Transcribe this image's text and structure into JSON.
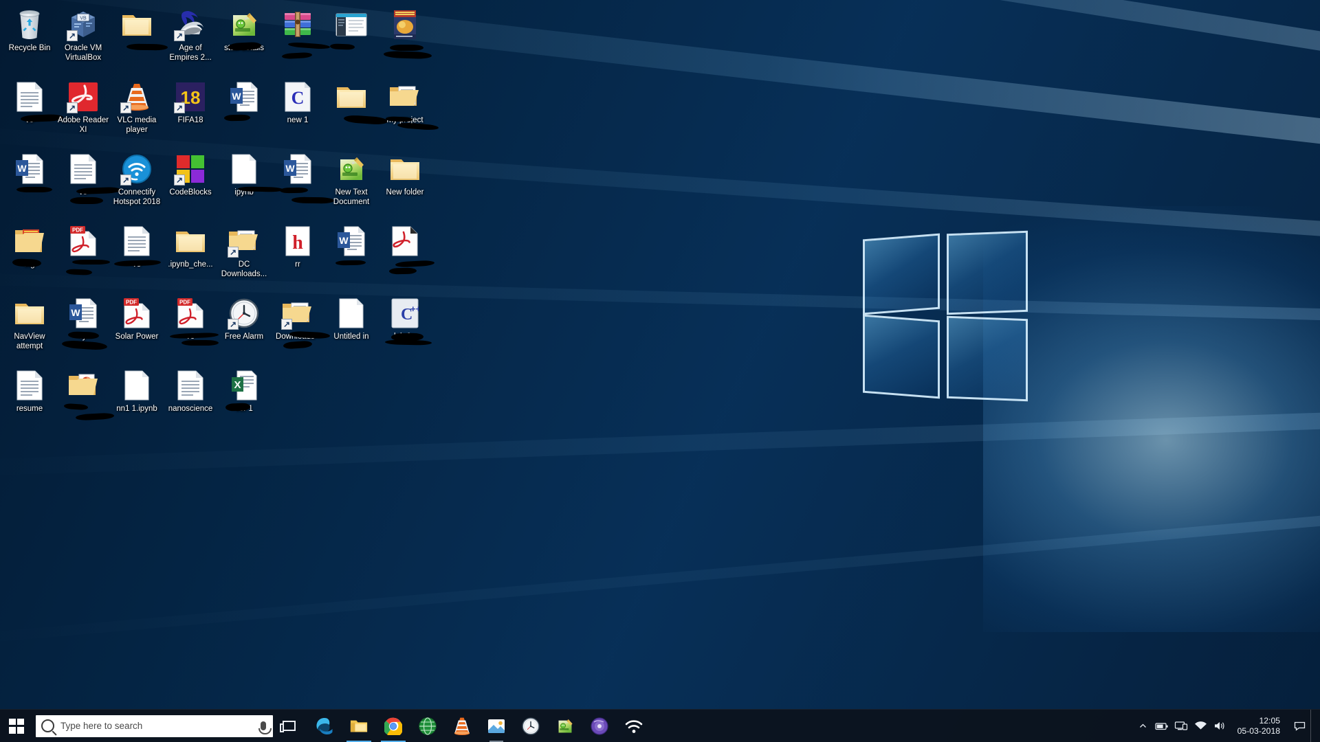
{
  "desktop": {
    "wallpaper_name": "windows-10-hero-wallpaper",
    "icons": [
      {
        "label": "Recycle Bin",
        "icon": "recycle-bin-icon",
        "redacted": false,
        "shortcut": false,
        "kind": "system"
      },
      {
        "label": "Oracle VM VirtualBox",
        "icon": "virtualbox-icon",
        "redacted": false,
        "shortcut": true,
        "kind": "app"
      },
      {
        "label": "",
        "icon": "folder-icon",
        "redacted": true,
        "shortcut": false,
        "kind": "folder"
      },
      {
        "label": "Age of Empires 2...",
        "icon": "age-of-empires-icon",
        "redacted": false,
        "shortcut": true,
        "kind": "app"
      },
      {
        "label": "stuff details",
        "icon": "notepadpp-icon",
        "redacted": true,
        "shortcut": false,
        "kind": "text"
      },
      {
        "label": "",
        "icon": "winrar-archive-icon",
        "redacted": true,
        "shortcut": false,
        "kind": "archive"
      },
      {
        "label": "",
        "icon": "app-window-icon",
        "redacted": true,
        "shortcut": false,
        "kind": "app"
      },
      {
        "label": "",
        "icon": "book-cover-icon",
        "redacted": true,
        "shortcut": false,
        "kind": "image"
      },
      {
        "label": "ve",
        "icon": "document-icon",
        "redacted": true,
        "shortcut": false,
        "kind": "document"
      },
      {
        "label": "Adobe Reader XI",
        "icon": "adobe-reader-icon",
        "redacted": false,
        "shortcut": true,
        "kind": "app"
      },
      {
        "label": "VLC media player",
        "icon": "vlc-cone-icon",
        "redacted": false,
        "shortcut": true,
        "kind": "app"
      },
      {
        "label": "FIFA18",
        "icon": "fifa18-icon",
        "redacted": false,
        "shortcut": true,
        "kind": "app"
      },
      {
        "label": "",
        "icon": "word-document-icon",
        "redacted": true,
        "shortcut": false,
        "kind": "word"
      },
      {
        "label": "new 1",
        "icon": "c-source-file-icon",
        "redacted": false,
        "shortcut": false,
        "kind": "code"
      },
      {
        "label": "",
        "icon": "folder-icon",
        "redacted": true,
        "shortcut": false,
        "kind": "folder"
      },
      {
        "label": "my project",
        "icon": "open-folder-icon",
        "redacted": true,
        "shortcut": false,
        "kind": "folder"
      },
      {
        "label": "",
        "icon": "word-document-icon",
        "redacted": true,
        "shortcut": false,
        "kind": "word"
      },
      {
        "label": "ve",
        "icon": "document-icon",
        "redacted": true,
        "shortcut": false,
        "kind": "document"
      },
      {
        "label": "Connectify Hotspot 2018",
        "icon": "connectify-icon",
        "redacted": false,
        "shortcut": true,
        "kind": "app"
      },
      {
        "label": "CodeBlocks",
        "icon": "codeblocks-icon",
        "redacted": false,
        "shortcut": true,
        "kind": "app"
      },
      {
        "label": "ipynb",
        "icon": "blank-document-icon",
        "redacted": true,
        "shortcut": false,
        "kind": "document"
      },
      {
        "label": "",
        "icon": "word-document-icon",
        "redacted": true,
        "shortcut": false,
        "kind": "word"
      },
      {
        "label": "New Text Document",
        "icon": "notepadpp-icon",
        "redacted": false,
        "shortcut": false,
        "kind": "text"
      },
      {
        "label": "New folder",
        "icon": "folder-icon",
        "redacted": false,
        "shortcut": false,
        "kind": "folder"
      },
      {
        "label": "ing",
        "icon": "book-folder-icon",
        "redacted": true,
        "shortcut": false,
        "kind": "folder"
      },
      {
        "label": "",
        "icon": "pdf-document-icon",
        "redacted": true,
        "shortcut": false,
        "kind": "pdf"
      },
      {
        "label": "ve",
        "icon": "document-icon",
        "redacted": true,
        "shortcut": false,
        "kind": "document"
      },
      {
        "label": ".ipynb_che...",
        "icon": "folder-icon",
        "redacted": false,
        "shortcut": false,
        "kind": "folder"
      },
      {
        "label": "DC Downloads...",
        "icon": "open-folder-icon",
        "redacted": false,
        "shortcut": true,
        "kind": "folder"
      },
      {
        "label": "rr",
        "icon": "h-file-icon",
        "redacted": false,
        "shortcut": false,
        "kind": "code"
      },
      {
        "label": "",
        "icon": "word-document-icon",
        "redacted": true,
        "shortcut": false,
        "kind": "word"
      },
      {
        "label": "",
        "icon": "adobe-document-icon",
        "redacted": true,
        "shortcut": false,
        "kind": "pdf"
      },
      {
        "label": "NavView attempt",
        "icon": "folder-icon",
        "redacted": false,
        "shortcut": false,
        "kind": "folder"
      },
      {
        "label": "fy",
        "icon": "word-document-icon",
        "redacted": true,
        "shortcut": false,
        "kind": "word"
      },
      {
        "label": "Solar Power",
        "icon": "pdf-document-icon",
        "redacted": false,
        "shortcut": false,
        "kind": "pdf"
      },
      {
        "label": "ve",
        "icon": "pdf-document-icon",
        "redacted": true,
        "shortcut": false,
        "kind": "pdf"
      },
      {
        "label": "Free Alarm",
        "icon": "clock-icon",
        "redacted": false,
        "shortcut": true,
        "kind": "app"
      },
      {
        "label": "Downloads -",
        "icon": "open-folder-icon",
        "redacted": true,
        "shortcut": true,
        "kind": "folder"
      },
      {
        "label": "Untitled in",
        "icon": "blank-document-icon",
        "redacted": false,
        "shortcut": false,
        "kind": "document"
      },
      {
        "label": "lab 2 -",
        "icon": "cpp-source-file-icon",
        "redacted": true,
        "shortcut": false,
        "kind": "code"
      },
      {
        "label": "resume",
        "icon": "document-icon",
        "redacted": false,
        "shortcut": false,
        "kind": "document"
      },
      {
        "label": "",
        "icon": "ppt-folder-icon",
        "redacted": true,
        "shortcut": false,
        "kind": "folder"
      },
      {
        "label": "nn1 1.ipynb",
        "icon": "blank-document-icon",
        "redacted": false,
        "shortcut": false,
        "kind": "document"
      },
      {
        "label": "nanoscience",
        "icon": "document-icon",
        "redacted": false,
        "shortcut": false,
        "kind": "document"
      },
      {
        "label": "ver 1",
        "icon": "excel-document-icon",
        "redacted": true,
        "shortcut": false,
        "kind": "excel"
      }
    ]
  },
  "taskbar": {
    "start_label": "Start",
    "search": {
      "placeholder": "Type here to search",
      "value": "",
      "icon": "search-icon",
      "mic_icon": "microphone-icon"
    },
    "task_view_label": "Task View",
    "apps": [
      {
        "name": "Microsoft Edge",
        "icon": "edge-icon",
        "state": "pinned"
      },
      {
        "name": "File Explorer",
        "icon": "file-explorer-icon",
        "state": "active"
      },
      {
        "name": "Google Chrome",
        "icon": "chrome-icon",
        "state": "active"
      },
      {
        "name": "Web Browser",
        "icon": "browser-globe-icon",
        "state": "pinned"
      },
      {
        "name": "VLC media player",
        "icon": "vlc-cone-icon",
        "state": "pinned"
      },
      {
        "name": "Photos",
        "icon": "photos-icon",
        "state": "running"
      },
      {
        "name": "Alarms & Clock",
        "icon": "clock-icon",
        "state": "pinned"
      },
      {
        "name": "Notepad++",
        "icon": "notepadpp-icon",
        "state": "pinned"
      },
      {
        "name": "Media Player",
        "icon": "media-disc-icon",
        "state": "pinned"
      },
      {
        "name": "Wireless Network",
        "icon": "wifi-app-icon",
        "state": "pinned"
      }
    ],
    "tray": {
      "overflow_icon": "chevron-up-icon",
      "items": [
        {
          "name": "Battery",
          "icon": "battery-icon"
        },
        {
          "name": "Network",
          "icon": "network-monitor-icon"
        },
        {
          "name": "Wi-Fi",
          "icon": "wifi-icon"
        },
        {
          "name": "Volume",
          "icon": "speaker-icon"
        }
      ],
      "clock": {
        "time": "12:05",
        "date": "05-03-2018"
      },
      "action_center_icon": "action-center-icon",
      "show_desktop_label": "Show desktop"
    }
  },
  "colors": {
    "accent": "#53b0ee",
    "taskbar_bg": "#0c121c",
    "desktop_blue": "#0d4a88",
    "word_blue": "#2b579a",
    "pdf_red": "#d32b2b",
    "label_text": "#ffffff"
  }
}
